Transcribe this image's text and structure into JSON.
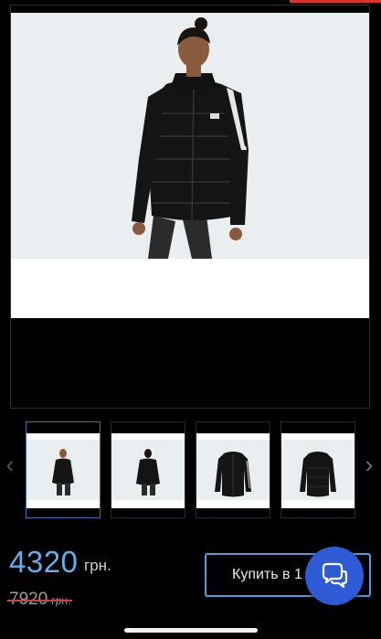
{
  "product": {
    "image": "black-puffer-jacket-photo",
    "price": "4320",
    "currency": "грн.",
    "old_price": "7920",
    "old_currency": "грн."
  },
  "gallery": {
    "thumbnails": [
      {
        "name": "thumb-front-model",
        "active": true
      },
      {
        "name": "thumb-back-model",
        "active": false
      },
      {
        "name": "thumb-front-flat",
        "active": false
      },
      {
        "name": "thumb-back-flat",
        "active": false
      }
    ],
    "prev_icon": "chevron-left-icon",
    "next_icon": "chevron-right-icon"
  },
  "actions": {
    "buy_label": "Купить в 1 кл",
    "chat_icon": "chat-bubbles-icon"
  },
  "colors": {
    "price": "#5fb1ea",
    "button_border": "#4a9fe0",
    "fab": "#2d5bd6",
    "strike": "#d04040"
  }
}
